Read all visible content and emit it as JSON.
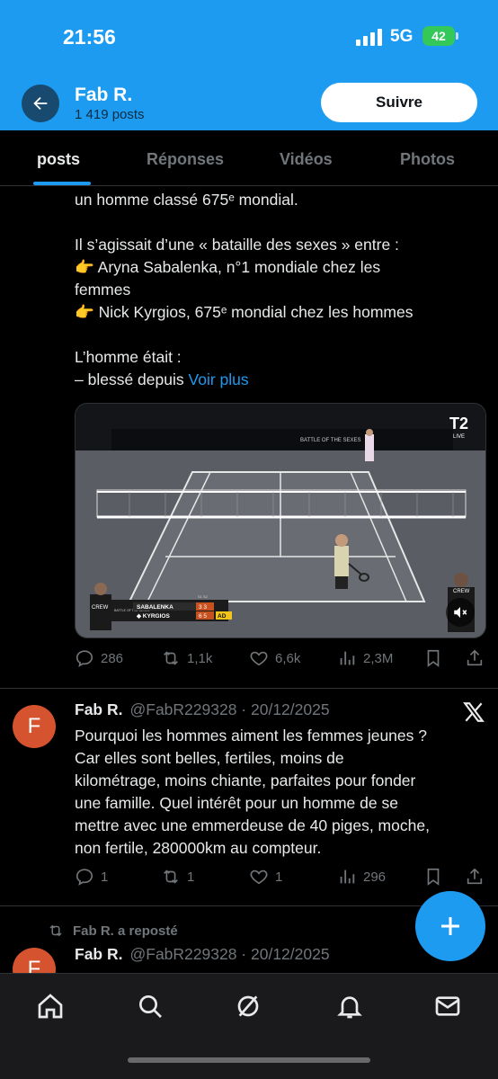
{
  "status_bar": {
    "time": "21:56",
    "network": "5G",
    "battery": "42"
  },
  "profile": {
    "name": "Fab R.",
    "posts_count": "1 419 posts",
    "follow_label": "Suivre"
  },
  "tabs": [
    {
      "label": "posts"
    },
    {
      "label": "Réponses"
    },
    {
      "label": "Vidéos"
    },
    {
      "label": "Photos"
    }
  ],
  "post1": {
    "lines": [
      "un homme classé 675ᵉ mondial.",
      "",
      "Il s’agissait d’une « bataille des sexes » entre :",
      "👉 Aryna Sabalenka, n°1 mondiale chez les",
      "femmes",
      "👉 Nick Kyrgios, 675ᵉ mondial chez les hommes",
      "",
      "L’homme était :"
    ],
    "last_line": "– blessé depuis",
    "voir_plus": "Voir plus",
    "media": {
      "board_banner_1": "BATTLE OF THE SEXES",
      "tv_badge": "T2",
      "tv_live": "LIVE",
      "crew_label": "CREW",
      "score_header": "S1 S2",
      "score_player_1": "SABALENKA",
      "score_player_1_sets": "3 3",
      "score_player_2": "◆ KYRGIOS",
      "score_player_2_sets": "6 5",
      "score_player_2_pts": "AD",
      "scoreboard_left": "BATTLE OF THE SEXES"
    },
    "stats": {
      "replies": "286",
      "reposts": "1,1k",
      "likes": "6,6k",
      "views": "2,3M"
    }
  },
  "tweet2": {
    "avatar_letter": "F",
    "name": "Fab R.",
    "handle": "@FabR229328 · 20/12/2025",
    "lines": [
      "Pourquoi les hommes aiment les femmes jeunes ?",
      "Car elles sont belles, fertiles, moins de",
      "kilométrage, moins chiante, parfaites pour fonder",
      "une famille. Quel intérêt pour un homme de se",
      "mettre avec une emmerdeuse de 40 piges, moche,",
      "non fertile, 280000km au compteur."
    ],
    "stats": {
      "replies": "1",
      "reposts": "1",
      "likes": "1",
      "views": "296"
    }
  },
  "tweet3": {
    "repost_label": "Fab R. a reposté",
    "avatar_letter": "F",
    "name": "Fab R.",
    "handle": "@FabR229328 · 20/12/2025"
  },
  "colors": {
    "accent": "#1d9bf0",
    "avatar": "#d5532e",
    "background": "#000000"
  },
  "icons": [
    "back-arrow-icon",
    "reply-icon",
    "repost-icon",
    "like-icon",
    "views-icon",
    "bookmark-icon",
    "share-icon",
    "x-logo-icon",
    "compose-plus-icon",
    "home-icon",
    "search-icon",
    "grok-icon",
    "notifications-icon",
    "messages-icon",
    "mute-icon"
  ]
}
